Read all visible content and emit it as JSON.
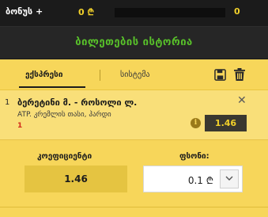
{
  "bonus": {
    "label": "ბონუს +",
    "amount": "0 ₾",
    "max": "0"
  },
  "history": {
    "label": "ბილეთების ისტორია"
  },
  "tabs": {
    "express": "ექსპრესი",
    "system": "სისტემა"
  },
  "bet": {
    "index": "1",
    "teams": "ბერეტინი მ. - როსოლი ლ.",
    "market": "ATP. კრემლის თასი, ჰარდი",
    "line": "1",
    "odds": "1.46",
    "info_icon": "info-icon"
  },
  "summary": {
    "coef_label": "კოეფიციენტი",
    "coef_value": "1.46",
    "stake_label": "ფსონი:",
    "stake_value": "0.1 ₾"
  },
  "colors": {
    "accent_yellow": "#f7d65a",
    "odds_yellow": "#f2d12a",
    "green_text": "#58c02a"
  }
}
